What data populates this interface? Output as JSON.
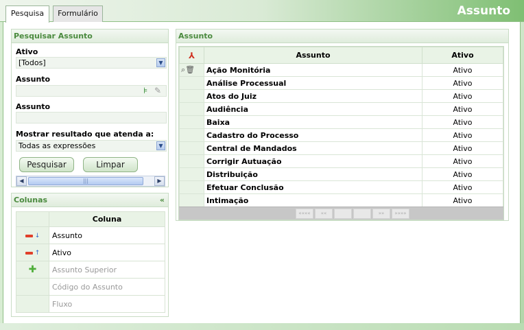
{
  "tabs": [
    {
      "label": "Pesquisa",
      "active": true
    },
    {
      "label": "Formulário",
      "active": false
    }
  ],
  "app_title": "Assunto",
  "search_panel": {
    "title": "Pesquisar Assunto",
    "ativo_label": "Ativo",
    "ativo_value": "[Todos]",
    "assunto_label": "Assunto",
    "assunto2_label": "Assunto",
    "match_label": "Mostrar resultado que atenda a:",
    "match_value": "Todas as expressões",
    "search_button": "Pesquisar",
    "clear_button": "Limpar"
  },
  "columns_panel": {
    "title": "Colunas",
    "collapse": "«",
    "header": "Coluna",
    "rows": [
      {
        "name": "Assunto",
        "selected": true,
        "sort": "down"
      },
      {
        "name": "Ativo",
        "selected": true,
        "sort": "up"
      },
      {
        "name": "Assunto Superior",
        "selected": false
      },
      {
        "name": "Código do Assunto",
        "selected": false
      },
      {
        "name": "Fluxo",
        "selected": false
      }
    ]
  },
  "results_panel": {
    "title": "Assunto",
    "col_assunto": "Assunto",
    "col_ativo": "Ativo",
    "rows": [
      {
        "assunto": "Ação Monitória",
        "ativo": "Ativo"
      },
      {
        "assunto": "Análise Processual",
        "ativo": "Ativo"
      },
      {
        "assunto": "Atos do Juiz",
        "ativo": "Ativo"
      },
      {
        "assunto": "Audiência",
        "ativo": "Ativo"
      },
      {
        "assunto": "Baixa",
        "ativo": "Ativo"
      },
      {
        "assunto": "Cadastro do Processo",
        "ativo": "Ativo"
      },
      {
        "assunto": "Central de Mandados",
        "ativo": "Ativo"
      },
      {
        "assunto": "Corrigir Autuação",
        "ativo": "Ativo"
      },
      {
        "assunto": "Distribuição",
        "ativo": "Ativo"
      },
      {
        "assunto": "Efetuar Conclusão",
        "ativo": "Ativo"
      },
      {
        "assunto": "Intimação",
        "ativo": "Ativo"
      }
    ],
    "pager": [
      "««««",
      "««",
      "",
      "",
      "»»",
      "»»»»"
    ]
  },
  "colors": {
    "accent_green": "#4a8a3e",
    "header_bg": "#e9f3e6",
    "title_bar_end": "#7fbf73"
  }
}
